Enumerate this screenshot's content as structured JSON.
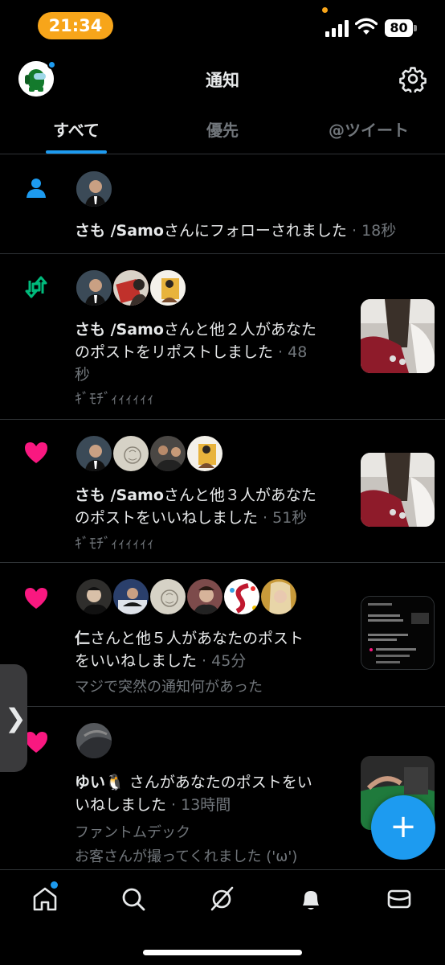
{
  "status_bar": {
    "time": "21:34",
    "battery": "80"
  },
  "header": {
    "title": "通知"
  },
  "tabs": [
    {
      "label": "すべて",
      "active": true
    },
    {
      "label": "優先",
      "active": false
    },
    {
      "label": "@ツイート",
      "active": false
    }
  ],
  "notifications": [
    {
      "type": "follow",
      "actor": "さも /Samo",
      "text": "さんにフォローされました",
      "time": "· 18秒"
    },
    {
      "type": "repost",
      "actor": "さも /Samo",
      "text_line1": "さんと他２人があなた",
      "text_line2": "のポストをリポストしました",
      "time_part1": " · 48",
      "time_part2": "秒",
      "post_text": "ｷﾞﾓﾁﾞｨｨｨｨｨｨ"
    },
    {
      "type": "like",
      "actor": "さも /Samo",
      "text_line1": "さんと他３人があなた",
      "text_line2": "のポストをいいねしました",
      "time": " · 51秒",
      "post_text": "ｷﾞﾓﾁﾞｨｨｨｨｨｨ"
    },
    {
      "type": "like",
      "actor": "仁",
      "text_line1": "さんと他５人があなたのポスト",
      "text_line2": "をいいねしました",
      "time": " · 45分",
      "post_text": "マジで突然の通知何があった"
    },
    {
      "type": "like",
      "actor": "ゆい🐧",
      "text_line1": " さんがあなたのポストをい",
      "text_line2": "いねしました",
      "time": " · 13時間",
      "post_text_line1": "ファントムデック",
      "post_text_line2": "お客さんが撮ってくれました ('ω')"
    }
  ],
  "fab": {
    "label": "+"
  },
  "side_handle": {
    "label": "❯"
  },
  "colors": {
    "accent": "#1d9bf0",
    "like": "#f91880",
    "repost": "#00ba7c",
    "muted": "#71767b"
  }
}
